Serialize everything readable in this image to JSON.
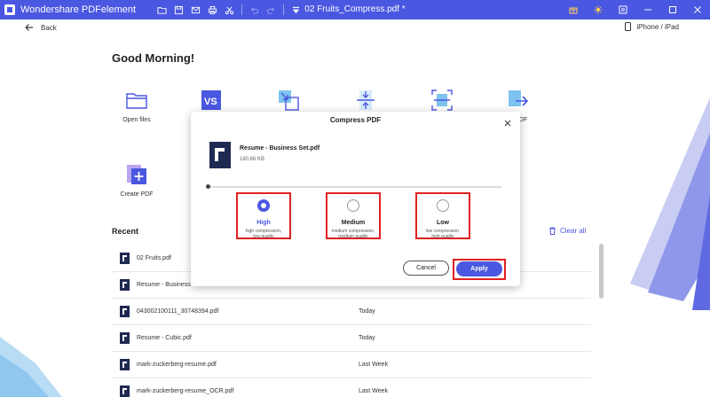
{
  "titlebar": {
    "app_name": "Wondershare PDFelement",
    "document_title": "02 Fruits_Compress.pdf *"
  },
  "nav": {
    "back_label": "Back",
    "device_label": "iPhone / iPad"
  },
  "home": {
    "greeting": "Good Morning!",
    "tiles": [
      {
        "label": "Open files",
        "icon": "folder-icon"
      },
      {
        "label": "",
        "icon": "convert-vs-icon"
      },
      {
        "label": "",
        "icon": "combine-arrows-icon"
      },
      {
        "label": "",
        "icon": "compress-icon"
      },
      {
        "label": "",
        "icon": "scan-ocr-icon"
      },
      {
        "label": "rt PDF",
        "icon": "export-pdf-icon"
      },
      {
        "label": "Create PDF",
        "icon": "create-pdf-icon"
      }
    ]
  },
  "recent": {
    "title": "Recent",
    "clear_all": "Clear all",
    "items": [
      {
        "name": "02 Fruits.pdf",
        "date": ""
      },
      {
        "name": "Resume - Business",
        "date": ""
      },
      {
        "name": "043002100111_30748394.pdf",
        "date": "Today"
      },
      {
        "name": "Resume - Cubic.pdf",
        "date": "Today"
      },
      {
        "name": "mark-zuckerberg-resume.pdf",
        "date": "Last Week"
      },
      {
        "name": "mark-zuckerberg-resume_OCR.pdf",
        "date": "Last Week"
      }
    ]
  },
  "dialog": {
    "title": "Compress PDF",
    "file_name": "Resume - Business Set.pdf",
    "file_size": "180.66 KB",
    "options": [
      {
        "label": "High",
        "desc1": "high compression,",
        "desc2": "low quality",
        "selected": true
      },
      {
        "label": "Medium",
        "desc1": "medium compression,",
        "desc2": "medium quality",
        "selected": false
      },
      {
        "label": "Low",
        "desc1": "low compression,",
        "desc2": "high quality",
        "selected": false
      }
    ],
    "cancel_label": "Cancel",
    "apply_label": "Apply"
  },
  "colors": {
    "brand": "#4a57e0",
    "highlight": "#e02020"
  }
}
